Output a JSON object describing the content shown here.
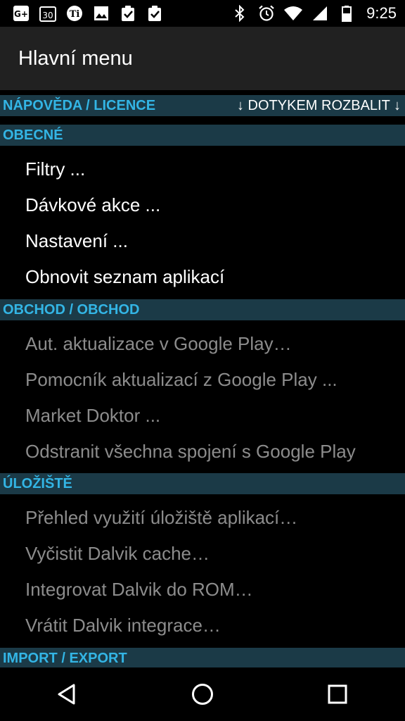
{
  "status_bar": {
    "time": "9:25",
    "calendar_day": "30",
    "notification_icons": [
      "google-plus-icon",
      "calendar-icon",
      "titanium-icon",
      "image-icon",
      "clipboard-check-icon",
      "clipboard-check-icon"
    ],
    "system_icons": [
      "bluetooth-icon",
      "alarm-icon",
      "wifi-icon",
      "signal-icon",
      "battery-icon"
    ]
  },
  "app_bar": {
    "title": "Hlavní menu"
  },
  "help_bar": {
    "left": "NÁPOVĚDA / LICENCE",
    "right": "↓ DOTYKEM ROZBALIT ↓"
  },
  "sections": {
    "general": {
      "header": "OBECNÉ",
      "items": [
        "Filtry ...",
        "Dávkové akce ...",
        "Nastavení ...",
        "Obnovit seznam aplikací"
      ]
    },
    "store": {
      "header": "OBCHOD / OBCHOD",
      "items": [
        "Aut. aktualizace v Google Play…",
        "Pomocník aktualizací z Google Play ...",
        "Market Doktor ...",
        "Odstranit všechna spojení s Google Play"
      ]
    },
    "storage": {
      "header": "ÚLOŽIŠTĚ",
      "items": [
        "Přehled využití úložiště aplikací…",
        "Vyčistit Dalvik cache…",
        "Integrovat Dalvik do ROM…",
        "Vrátit Dalvik integrace…"
      ]
    },
    "import_export": {
      "header": "IMPORT / EXPORT"
    }
  },
  "colors": {
    "accent": "#33b5e5",
    "section_bg": "#1b3a47",
    "appbar_bg": "#212121",
    "disabled_text": "#8c8c8c"
  }
}
